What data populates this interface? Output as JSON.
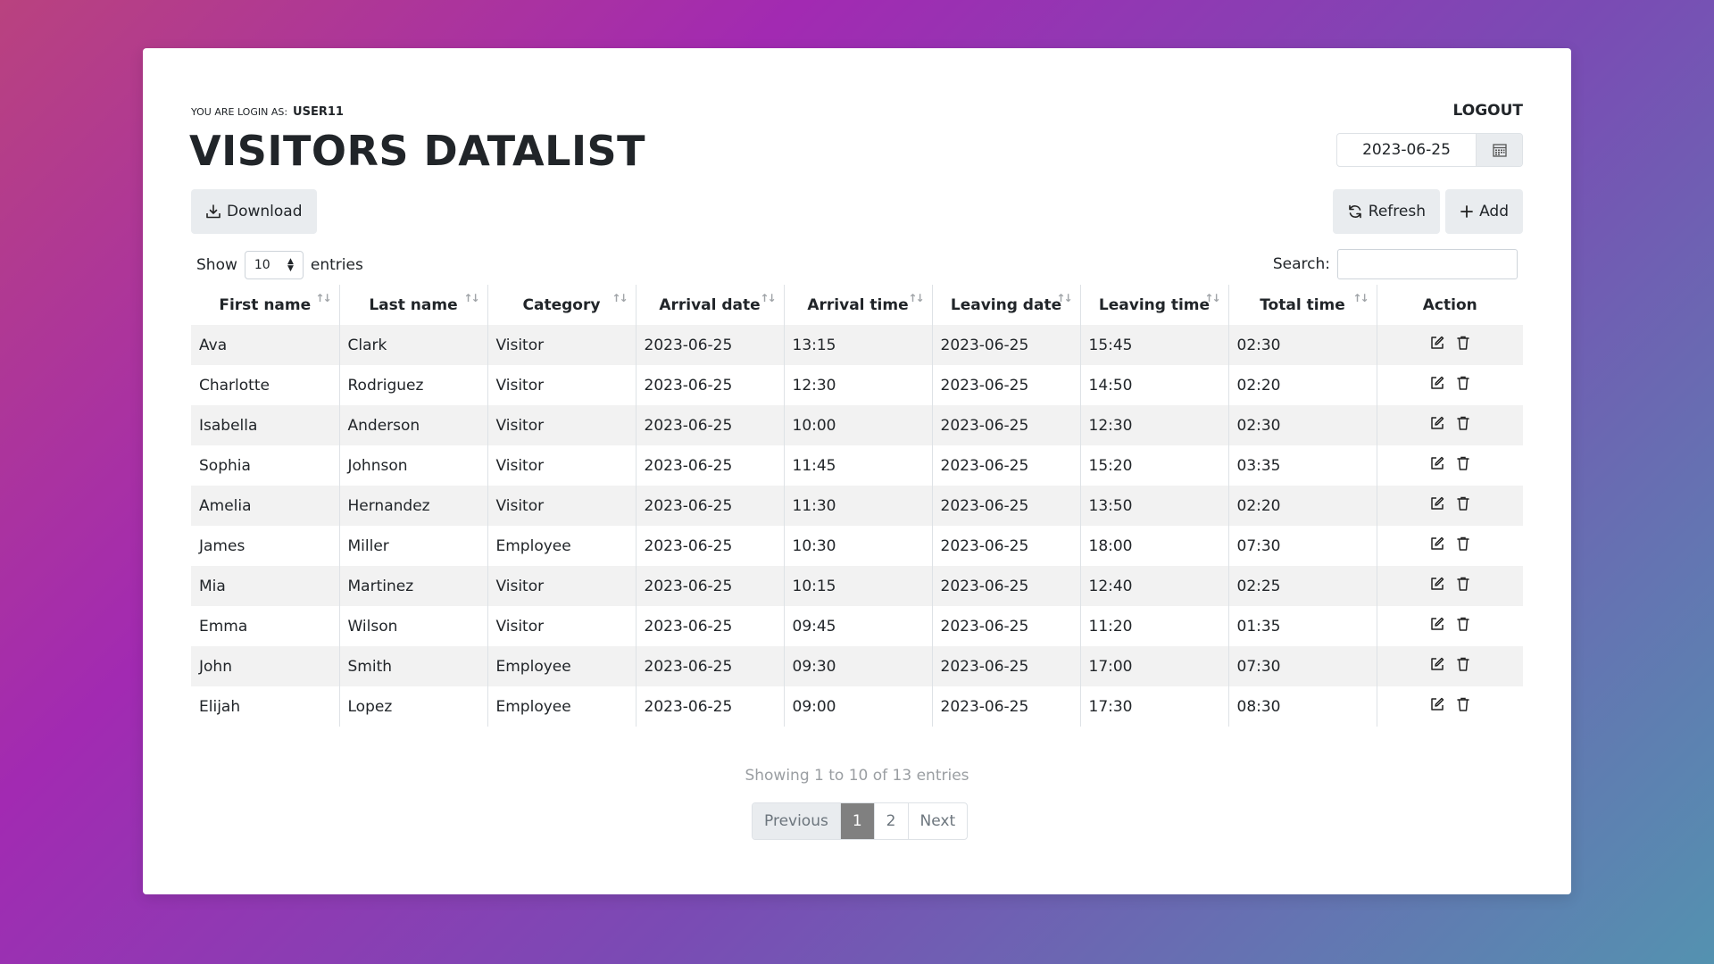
{
  "header": {
    "login_label": "YOU ARE LOGIN AS:",
    "login_user": "USER11",
    "title": "VISITORS DATALIST",
    "logout_label": "LOGOUT",
    "date_value": "2023-06-25"
  },
  "toolbar": {
    "download_label": "Download",
    "refresh_label": "Refresh",
    "add_label": "Add"
  },
  "controls": {
    "show_label": "Show",
    "page_size": "10",
    "entries_label": "entries",
    "search_label": "Search:"
  },
  "table": {
    "columns": [
      "First name",
      "Last name",
      "Category",
      "Arrival date",
      "Arrival time",
      "Leaving date",
      "Leaving time",
      "Total time",
      "Action"
    ],
    "rows": [
      [
        "Ava",
        "Clark",
        "Visitor",
        "2023-06-25",
        "13:15",
        "2023-06-25",
        "15:45",
        "02:30"
      ],
      [
        "Charlotte",
        "Rodriguez",
        "Visitor",
        "2023-06-25",
        "12:30",
        "2023-06-25",
        "14:50",
        "02:20"
      ],
      [
        "Isabella",
        "Anderson",
        "Visitor",
        "2023-06-25",
        "10:00",
        "2023-06-25",
        "12:30",
        "02:30"
      ],
      [
        "Sophia",
        "Johnson",
        "Visitor",
        "2023-06-25",
        "11:45",
        "2023-06-25",
        "15:20",
        "03:35"
      ],
      [
        "Amelia",
        "Hernandez",
        "Visitor",
        "2023-06-25",
        "11:30",
        "2023-06-25",
        "13:50",
        "02:20"
      ],
      [
        "James",
        "Miller",
        "Employee",
        "2023-06-25",
        "10:30",
        "2023-06-25",
        "18:00",
        "07:30"
      ],
      [
        "Mia",
        "Martinez",
        "Visitor",
        "2023-06-25",
        "10:15",
        "2023-06-25",
        "12:40",
        "02:25"
      ],
      [
        "Emma",
        "Wilson",
        "Visitor",
        "2023-06-25",
        "09:45",
        "2023-06-25",
        "11:20",
        "01:35"
      ],
      [
        "John",
        "Smith",
        "Employee",
        "2023-06-25",
        "09:30",
        "2023-06-25",
        "17:00",
        "07:30"
      ],
      [
        "Elijah",
        "Lopez",
        "Employee",
        "2023-06-25",
        "09:00",
        "2023-06-25",
        "17:30",
        "08:30"
      ]
    ]
  },
  "footer": {
    "info": "Showing 1 to 10 of 13 entries",
    "prev_label": "Previous",
    "pages": [
      "1",
      "2"
    ],
    "next_label": "Next"
  },
  "icons": {
    "download": "download-icon",
    "refresh": "refresh-icon",
    "add": "plus-icon",
    "calendar": "calendar-icon",
    "edit": "edit-icon",
    "delete": "trash-icon",
    "sort": "sort-icon"
  }
}
